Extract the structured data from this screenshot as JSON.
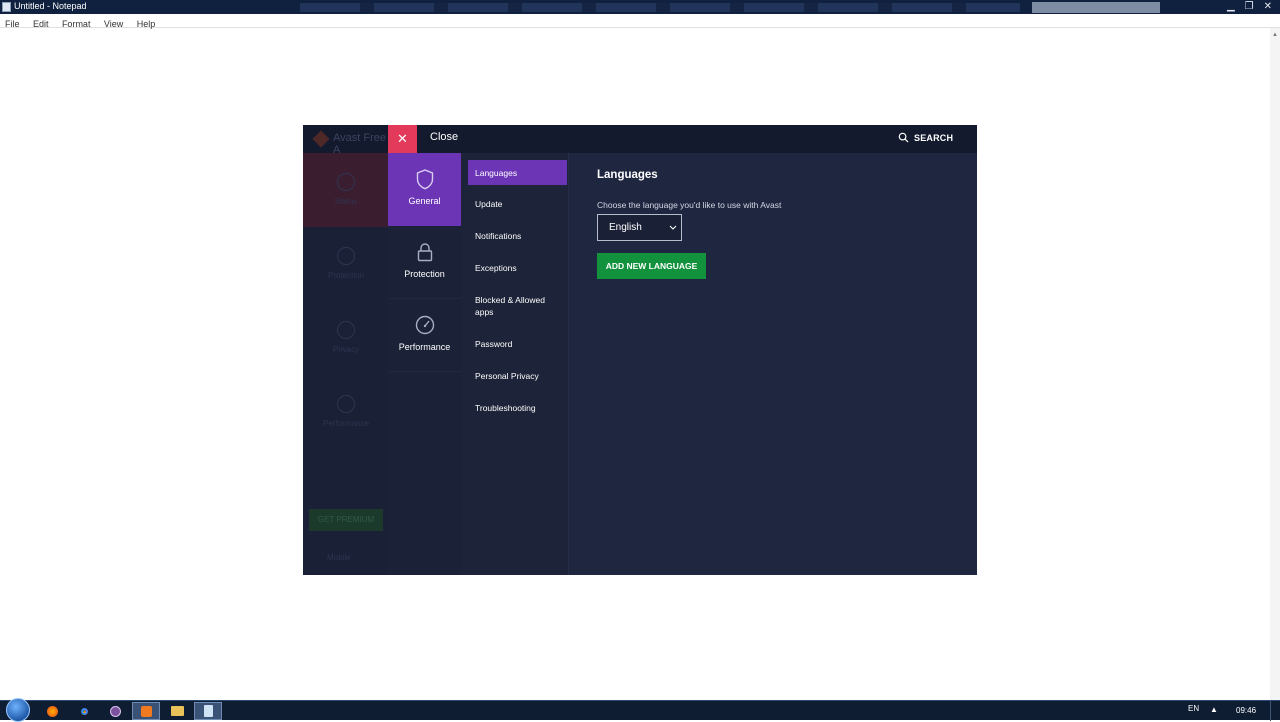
{
  "notepad": {
    "title": "Untitled - Notepad",
    "menu": [
      "File",
      "Edit",
      "Format",
      "View",
      "Help"
    ]
  },
  "avast": {
    "background_app_title": "Avast Free A",
    "background_nav": [
      "Status",
      "Protection",
      "Privacy",
      "Performance"
    ],
    "background_premium": "GET PREMIUM",
    "background_mobile": "Mobile",
    "close_label": "Close",
    "search_label": "SEARCH",
    "categories": [
      {
        "label": "General",
        "icon": "shield-icon",
        "active": true
      },
      {
        "label": "Protection",
        "icon": "lock-icon",
        "active": false
      },
      {
        "label": "Performance",
        "icon": "speedometer-icon",
        "active": false
      }
    ],
    "subsections": [
      {
        "label": "Languages",
        "active": true
      },
      {
        "label": "Update"
      },
      {
        "label": "Notifications"
      },
      {
        "label": "Exceptions"
      },
      {
        "label": "Blocked & Allowed apps"
      },
      {
        "label": "Password"
      },
      {
        "label": "Personal Privacy"
      },
      {
        "label": "Troubleshooting"
      }
    ],
    "content": {
      "title": "Languages",
      "description": "Choose the language you'd like to use with Avast",
      "selected_language": "English",
      "add_button": "ADD NEW LANGUAGE"
    },
    "colors": {
      "accent_purple": "#6c35b6",
      "close_red": "#e33a5c",
      "button_green": "#13923d",
      "panel_bg": "#1f2640"
    }
  },
  "taskbar": {
    "apps": [
      "firefox-icon",
      "chrome-icon",
      "viber-icon",
      "avast-icon",
      "explorer-icon",
      "notepad-icon"
    ],
    "language": "EN",
    "time": "09:46"
  }
}
